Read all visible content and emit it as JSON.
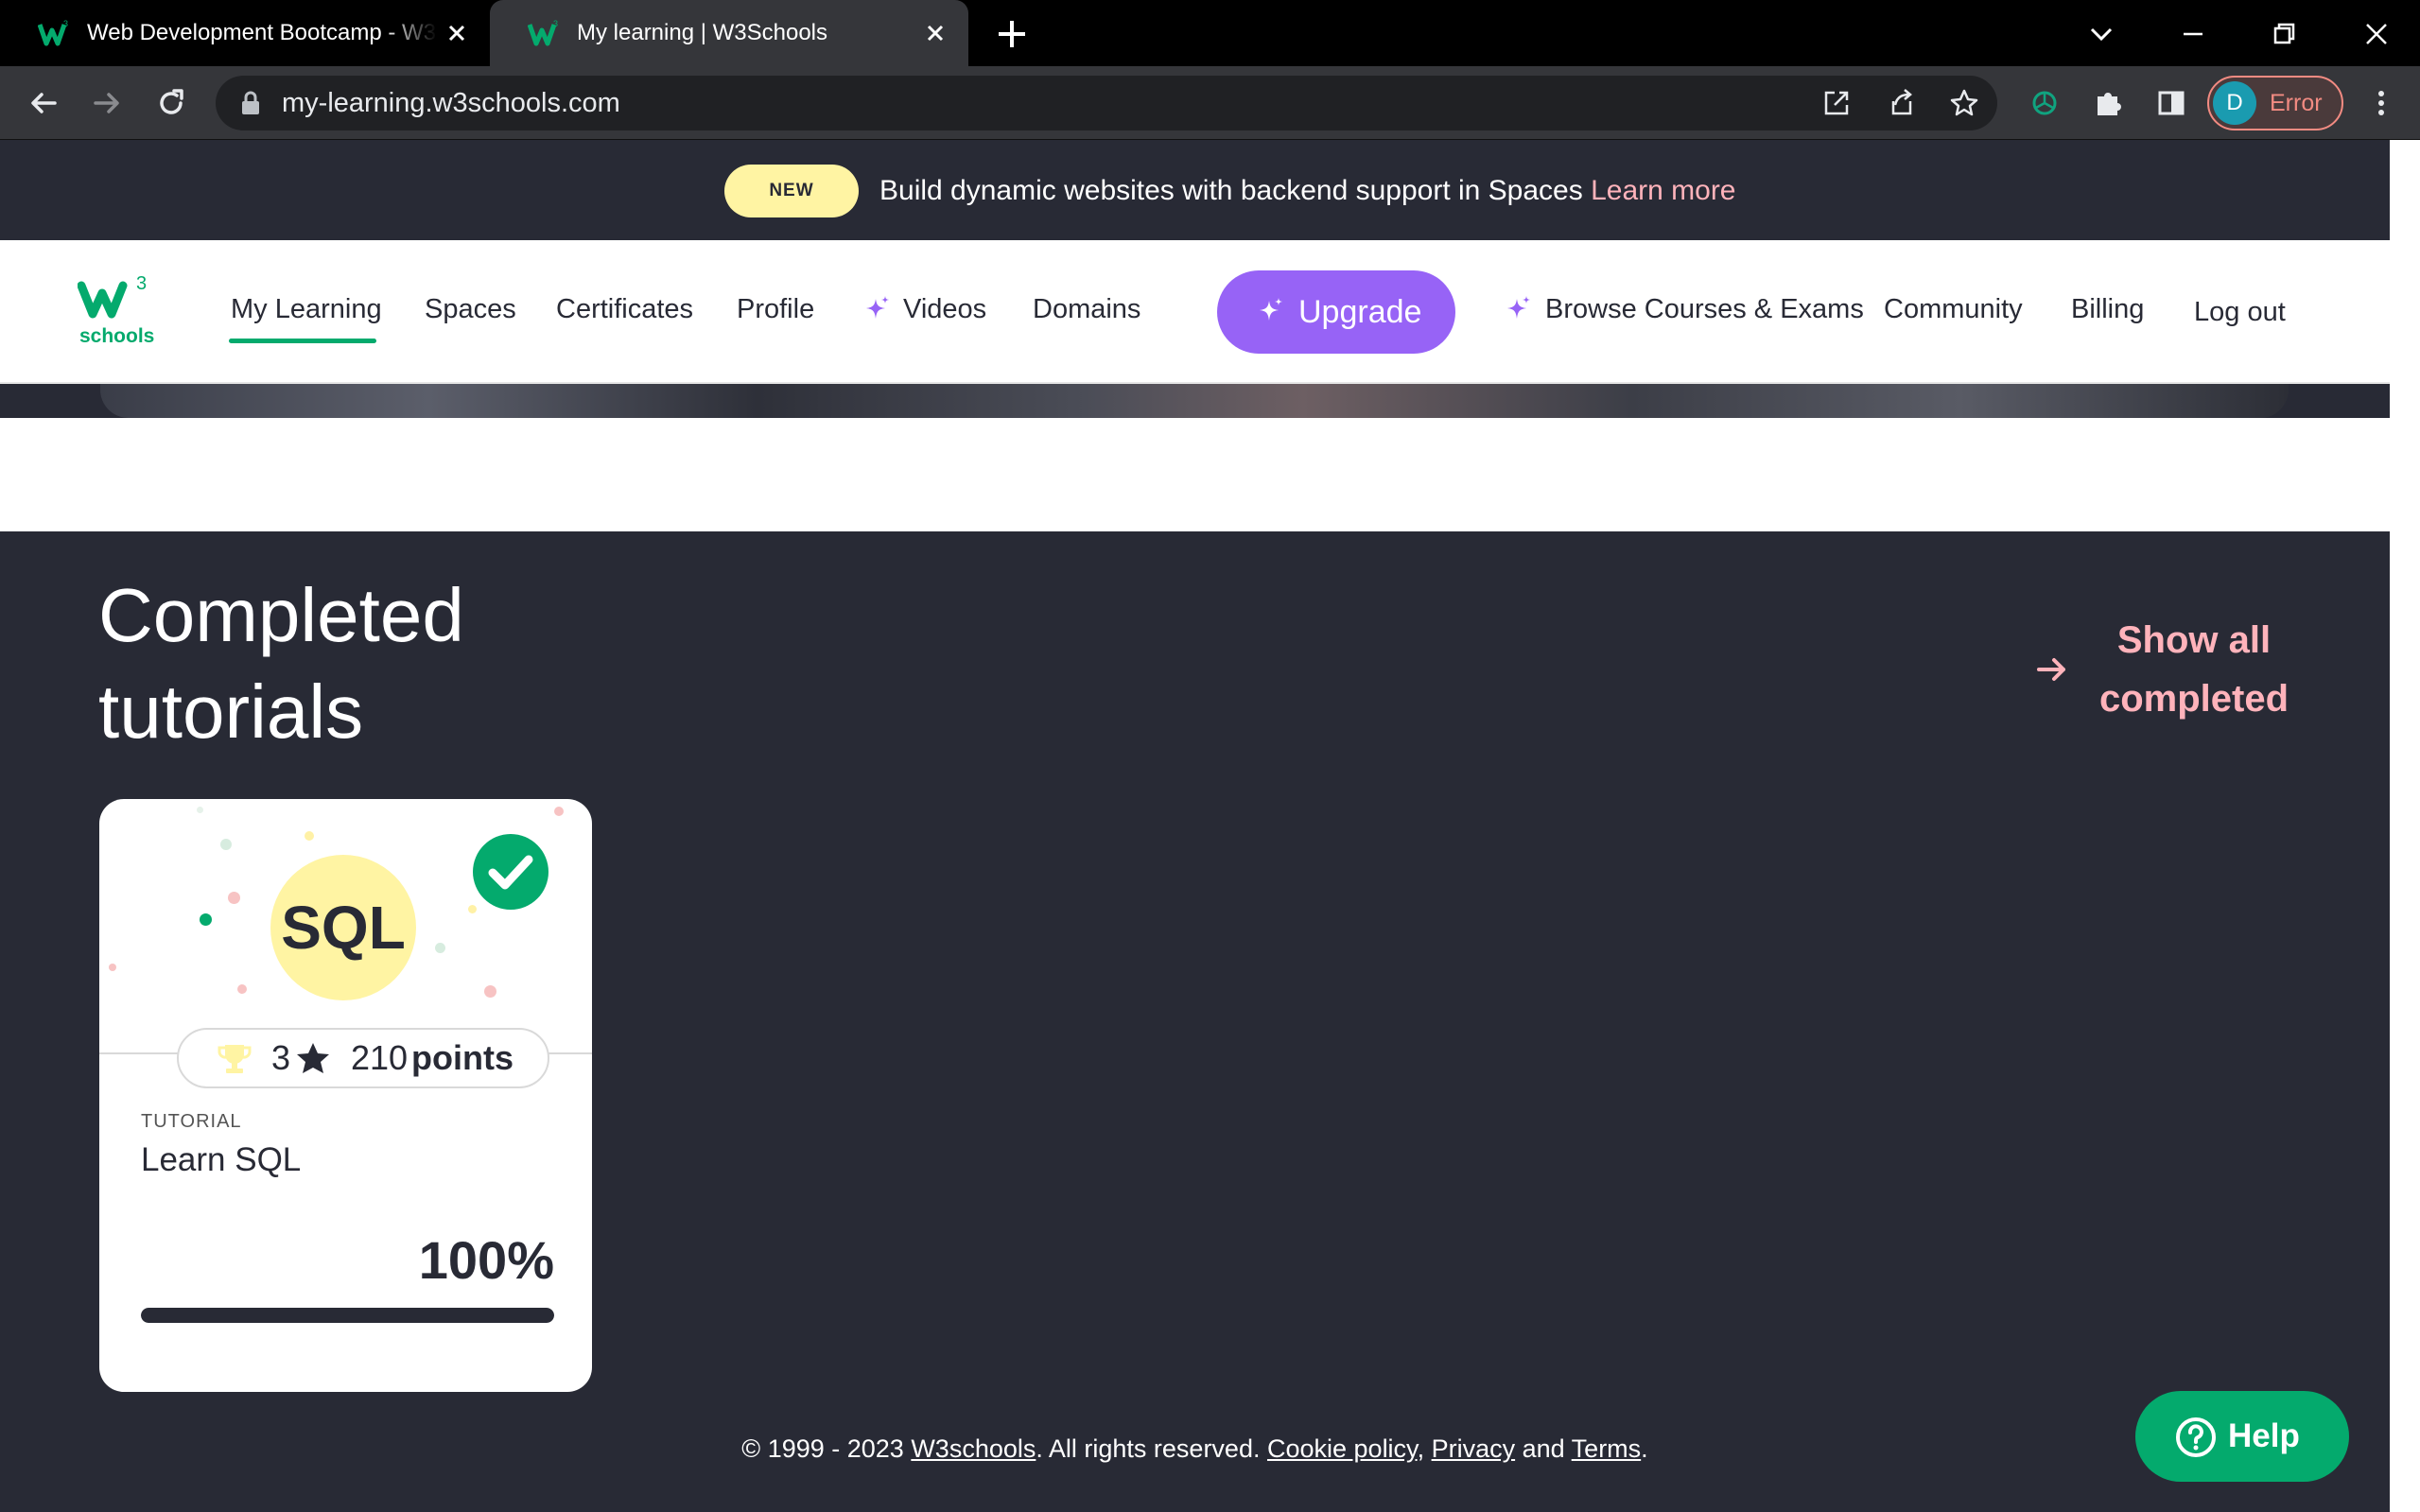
{
  "browser": {
    "tabs": [
      {
        "title": "Web Development Bootcamp - W3S",
        "active": false
      },
      {
        "title": "My learning | W3Schools",
        "active": true
      }
    ],
    "url": "my-learning.w3schools.com",
    "profile": {
      "initial": "D",
      "status": "Error"
    }
  },
  "announcement": {
    "badge": "NEW",
    "text": "Build dynamic websites with backend support in Spaces ",
    "link": "Learn more"
  },
  "nav": {
    "logo_text": "schools",
    "logo_superscript": "3",
    "items": [
      {
        "label": "My Learning",
        "active": true
      },
      {
        "label": "Spaces"
      },
      {
        "label": "Certificates"
      },
      {
        "label": "Profile"
      },
      {
        "label": "Videos",
        "icon": "sparkle-icon"
      },
      {
        "label": "Domains"
      },
      {
        "label": "Upgrade",
        "icon": "sparkle-icon",
        "style": "button"
      },
      {
        "label": "Browse Courses & Exams",
        "icon": "sparkle-icon"
      },
      {
        "label": "Community"
      },
      {
        "label": "Billing"
      },
      {
        "label": "Log out"
      }
    ]
  },
  "completed": {
    "title_line1": "Completed",
    "title_line2": "tutorials",
    "show_all_line1": "Show all",
    "show_all_line2": "completed",
    "cards": [
      {
        "badge": "SQL",
        "stars": "3",
        "points_value": "210",
        "points_label": "points",
        "type": "TUTORIAL",
        "title": "Learn SQL",
        "progress_label": "100%",
        "progress": 1.0
      }
    ]
  },
  "footer": {
    "copyright": "© 1999 - 2023 ",
    "site": "W3schools",
    "rights": ". All rights reserved. ",
    "cookie": "Cookie policy",
    "comma": ", ",
    "privacy": "Privacy",
    "and": " and ",
    "terms": "Terms",
    "period": "."
  },
  "help": {
    "label": "Help"
  },
  "colors": {
    "brand_green": "#04aa6d",
    "dark": "#282a35",
    "upgrade_purple": "#9763f6",
    "accent_pink": "#ffb3bb",
    "badge_yellow": "#fff4a3"
  }
}
